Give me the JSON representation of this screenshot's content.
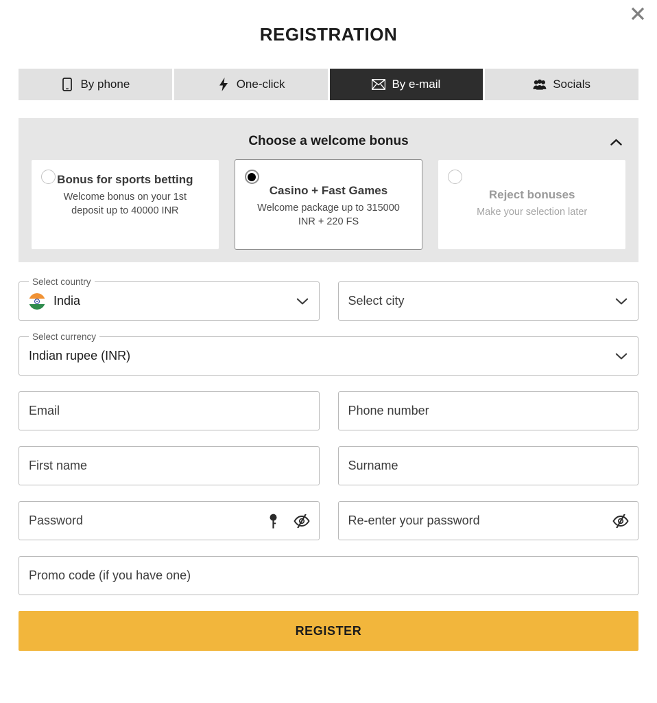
{
  "header": {
    "title": "REGISTRATION",
    "close_label": "close-icon"
  },
  "tabs": [
    {
      "label": "By phone",
      "icon": "mobile-phone-icon",
      "active": false
    },
    {
      "label": "One-click",
      "icon": "lightning-bolt-icon",
      "active": false
    },
    {
      "label": "By e-mail",
      "icon": "envelope-icon",
      "active": true
    },
    {
      "label": "Socials",
      "icon": "people-group-icon",
      "active": false
    }
  ],
  "bonus": {
    "heading": "Choose a welcome bonus",
    "collapse_icon": "chevron-up-icon",
    "cards": [
      {
        "title": "Bonus for sports betting",
        "desc": "Welcome bonus on your 1st deposit up to 40000 INR",
        "selected": false,
        "muted": false
      },
      {
        "title": "Casino + Fast Games",
        "desc": "Welcome package up to 315000 INR + 220 FS",
        "selected": true,
        "muted": false
      },
      {
        "title": "Reject bonuses",
        "desc": "Make your selection later",
        "selected": false,
        "muted": true
      }
    ]
  },
  "form": {
    "country": {
      "legend": "Select country",
      "value": "India",
      "flag": "india-flag-icon"
    },
    "city": {
      "placeholder": "Select city"
    },
    "currency": {
      "legend": "Select currency",
      "value": "Indian rupee (INR)"
    },
    "email": {
      "placeholder": "Email",
      "value": ""
    },
    "phone": {
      "placeholder": "Phone number",
      "value": ""
    },
    "first_name": {
      "placeholder": "First name",
      "value": ""
    },
    "surname": {
      "placeholder": "Surname",
      "value": ""
    },
    "password": {
      "placeholder": "Password",
      "value": "",
      "generate_icon": "key-icon",
      "visibility_icon": "eye-slash-icon"
    },
    "password_confirm": {
      "placeholder": "Re-enter your password",
      "value": "",
      "visibility_icon": "eye-slash-icon"
    },
    "promo": {
      "placeholder": "Promo code (if you have one)",
      "value": ""
    }
  },
  "submit": {
    "label": "REGISTER"
  },
  "colors": {
    "accent": "#f2b63c",
    "tab_active_bg": "#2d2d2d",
    "tab_inactive_bg": "#e1e1e1",
    "panel_bg": "#e6e6e6",
    "border": "#b9b9b9"
  }
}
